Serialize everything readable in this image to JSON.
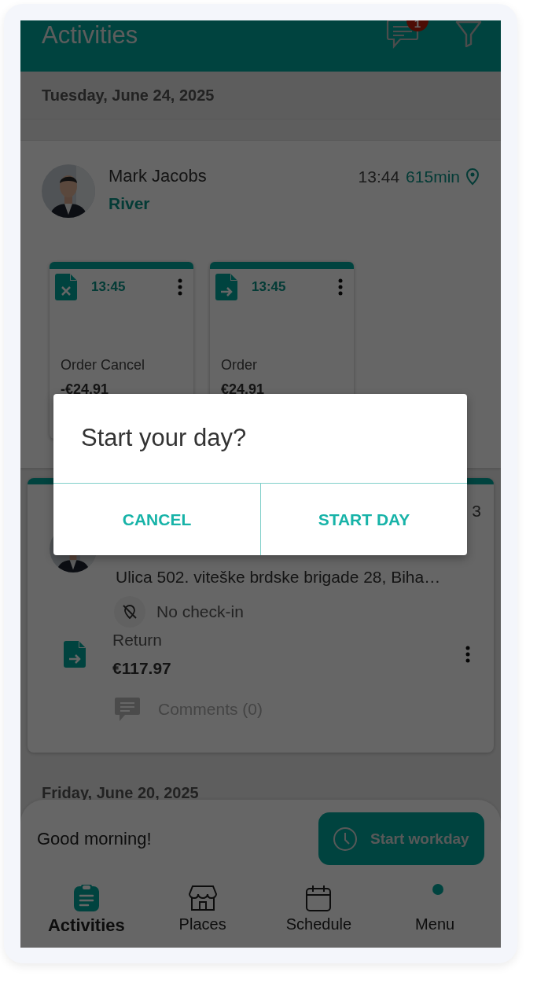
{
  "header": {
    "title": "Activities",
    "badge": "1"
  },
  "date_heading": "Tuesday, June 24, 2025",
  "visit": {
    "name": "Mark Jacobs",
    "place": "River",
    "time": "13:44",
    "duration": "615min",
    "documents": [
      {
        "kind": "cancel",
        "time": "13:45",
        "label": "Order Cancel",
        "amount": "-€24.91"
      },
      {
        "kind": "forward",
        "time": "13:45",
        "label": "Order",
        "amount": "€24.91"
      }
    ]
  },
  "visit_2": {
    "time_fragment": "3",
    "address": "Ulica 502. viteške brdske brigade 28, Biha…",
    "check_in": "No check-in",
    "document": {
      "kind": "forward",
      "label": "Return",
      "amount": "€117.97"
    },
    "comments": "Comments (0)"
  },
  "next_date": "Friday, June 20, 2025",
  "workday": {
    "greeting": "Good morning!",
    "button": "Start workday"
  },
  "nav": [
    {
      "kind": "clipboard",
      "label": "Activities",
      "selected": true,
      "dot": false
    },
    {
      "kind": "store",
      "label": "Places",
      "selected": false,
      "dot": false
    },
    {
      "kind": "calendar",
      "label": "Schedule",
      "selected": false,
      "dot": false
    },
    {
      "kind": "none",
      "label": "Menu",
      "selected": false,
      "dot": true
    }
  ],
  "dialog": {
    "title": "Start your day?",
    "buttons": [
      "CANCEL",
      "START DAY"
    ]
  }
}
